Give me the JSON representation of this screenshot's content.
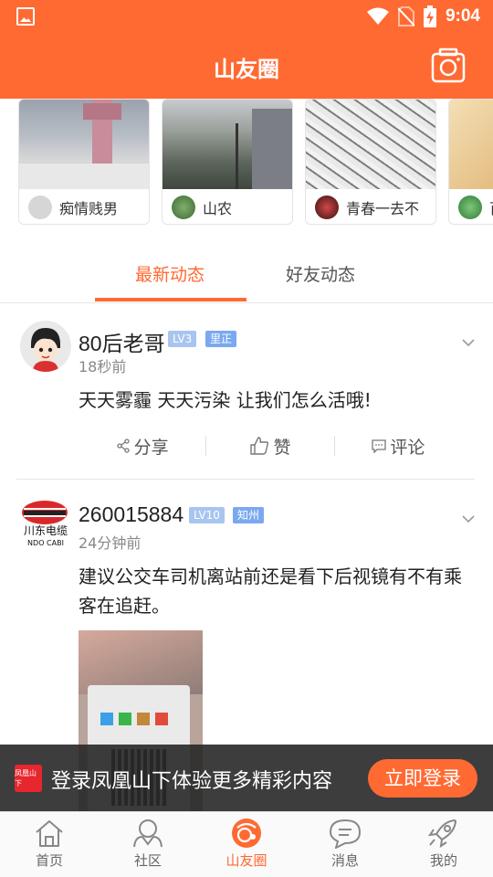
{
  "status_bar": {
    "time": "9:04"
  },
  "header": {
    "title": "山友圈"
  },
  "carousel": [
    {
      "username": "痴情贱男"
    },
    {
      "username": "山农"
    },
    {
      "username": "青春一去不"
    },
    {
      "username": "百"
    }
  ],
  "tabs": [
    {
      "label": "最新动态",
      "active": true
    },
    {
      "label": "好友动态",
      "active": false
    }
  ],
  "posts": [
    {
      "username": "80后老哥",
      "level": "LV3",
      "location": "里正",
      "time": "18秒前",
      "text": "天天雾霾 天天污染 让我们怎么活哦!",
      "actions": {
        "share": "分享",
        "like": "赞",
        "comment": "评论"
      }
    },
    {
      "username": "260015884",
      "level": "LV10",
      "location": "知州",
      "time": "24分钟前",
      "text": "建议公交车司机离站前还是看下后视镜有不有乘客在追赶。"
    }
  ],
  "avatar_logo_text": "川东电缆",
  "avatar_logo_sub": "NDO CABI",
  "banner": {
    "logo_text": "凤凰山下",
    "text": "登录凤凰山下体验更多精彩内容",
    "button": "立即登录"
  },
  "bottom_nav": [
    {
      "label": "首页",
      "icon": "home-icon",
      "active": false
    },
    {
      "label": "社区",
      "icon": "community-icon",
      "active": false
    },
    {
      "label": "山友圈",
      "icon": "circle-icon",
      "active": true
    },
    {
      "label": "消息",
      "icon": "message-icon",
      "active": false
    },
    {
      "label": "我的",
      "icon": "rocket-icon",
      "active": false
    }
  ],
  "colors": {
    "accent": "#ff6a33",
    "badge_level": "#a8c5f0",
    "badge_location": "#7aa9ef"
  }
}
